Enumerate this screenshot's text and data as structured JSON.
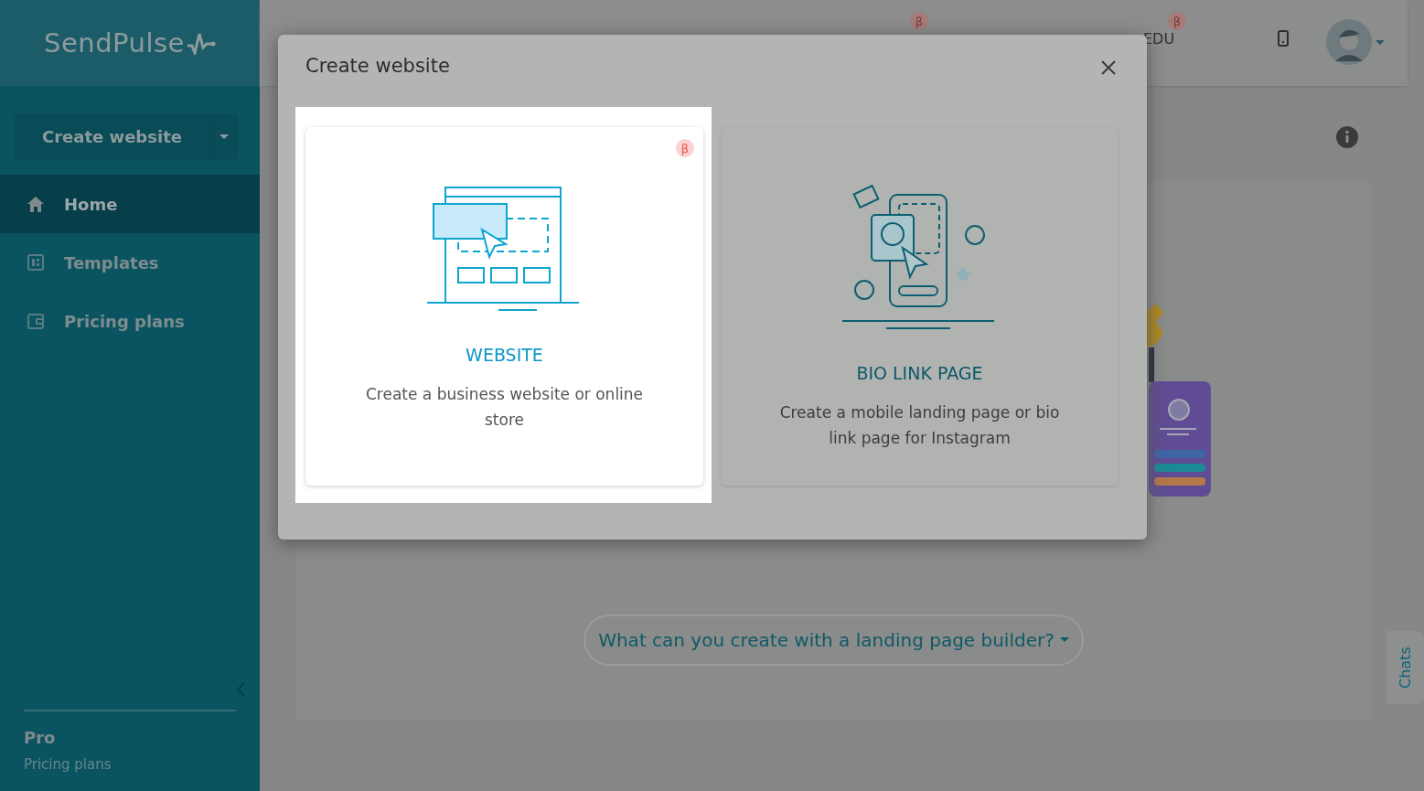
{
  "sidebar": {
    "logo": "SendPulse",
    "create_button": "Create website",
    "items": [
      {
        "label": "Home",
        "kind": "home",
        "selected": true
      },
      {
        "label": "Templates",
        "kind": "templates",
        "selected": false
      },
      {
        "label": "Pricing plans",
        "kind": "wallet",
        "selected": false
      }
    ],
    "footer": {
      "plan": "Pro",
      "link": "Pricing plans"
    }
  },
  "header": {
    "badges": [
      "β",
      "β"
    ],
    "label": "EDU"
  },
  "main": {
    "help_button": "What can you create with a landing page builder?",
    "chats": "Chats"
  },
  "modal": {
    "title": "Create website",
    "options": [
      {
        "kind": "website",
        "title": "WEBSITE",
        "description": "Create a business website or online store",
        "badge": "β",
        "highlighted": true
      },
      {
        "kind": "bio",
        "title": "BIO LINK PAGE",
        "description": "Create a mobile landing page or bio link page for Instagram",
        "highlighted": false
      }
    ]
  }
}
